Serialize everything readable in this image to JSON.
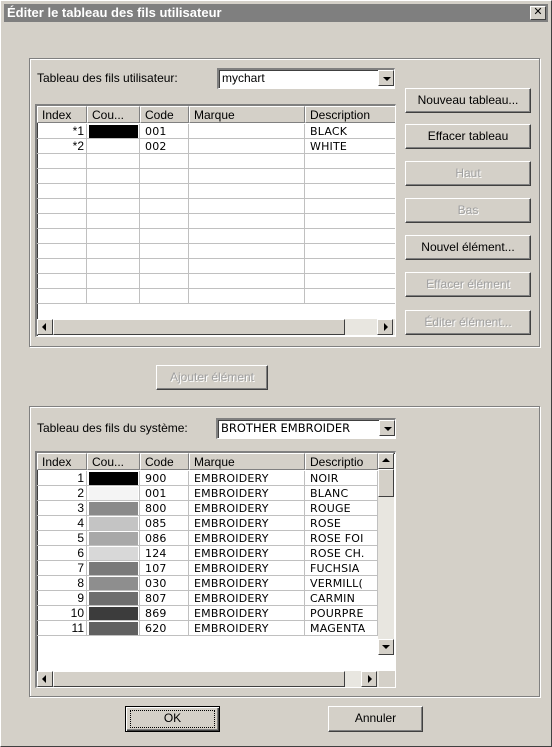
{
  "window": {
    "title": "Éditer le tableau des fils utilisateur",
    "close_glyph": "✕"
  },
  "user_table": {
    "label": "Tableau des fils utilisateur:",
    "selected": "mychart",
    "columns": [
      "Index",
      "Cou...",
      "Code",
      "Marque",
      "Description"
    ],
    "rows": [
      {
        "index": "*1",
        "color": "#000000",
        "code": "001",
        "brand": "",
        "description": "BLACK"
      },
      {
        "index": "*2",
        "color": "#ffffff",
        "code": "002",
        "brand": "",
        "description": "WHITE"
      }
    ],
    "empty_rows": 10
  },
  "buttons": {
    "new_table": "Nouveau tableau...",
    "delete_table": "Effacer tableau",
    "up": "Haut",
    "down": "Bas",
    "new_item": "Nouvel élément...",
    "delete_item": "Effacer élément",
    "edit_item": "Éditer élément...",
    "add_item": "Ajouter élément",
    "ok": "OK",
    "cancel": "Annuler"
  },
  "system_table": {
    "label": "Tableau des fils du système:",
    "selected": "BROTHER EMBROIDER",
    "columns": [
      "Index",
      "Cou...",
      "Code",
      "Marque",
      "Descriptio"
    ],
    "rows": [
      {
        "index": "1",
        "color": "#000000",
        "code": "900",
        "brand": "EMBROIDERY",
        "description": "NOIR"
      },
      {
        "index": "2",
        "color": "#f4f4f4",
        "code": "001",
        "brand": "EMBROIDERY",
        "description": "BLANC"
      },
      {
        "index": "3",
        "color": "#8a8a8a",
        "code": "800",
        "brand": "EMBROIDERY",
        "description": "ROUGE"
      },
      {
        "index": "4",
        "color": "#c4c4c4",
        "code": "085",
        "brand": "EMBROIDERY",
        "description": "ROSE"
      },
      {
        "index": "5",
        "color": "#a8a8a8",
        "code": "086",
        "brand": "EMBROIDERY",
        "description": "ROSE FOI"
      },
      {
        "index": "6",
        "color": "#d8d8d8",
        "code": "124",
        "brand": "EMBROIDERY",
        "description": "ROSE CH."
      },
      {
        "index": "7",
        "color": "#7a7a7a",
        "code": "107",
        "brand": "EMBROIDERY",
        "description": "FUCHSIA"
      },
      {
        "index": "8",
        "color": "#8e8e8e",
        "code": "030",
        "brand": "EMBROIDERY",
        "description": "VERMILL("
      },
      {
        "index": "9",
        "color": "#6e6e6e",
        "code": "807",
        "brand": "EMBROIDERY",
        "description": "CARMIN"
      },
      {
        "index": "10",
        "color": "#3c3c3c",
        "code": "869",
        "brand": "EMBROIDERY",
        "description": "POURPRE"
      },
      {
        "index": "11",
        "color": "#606060",
        "code": "620",
        "brand": "EMBROIDERY",
        "description": "MAGENTA"
      }
    ]
  }
}
